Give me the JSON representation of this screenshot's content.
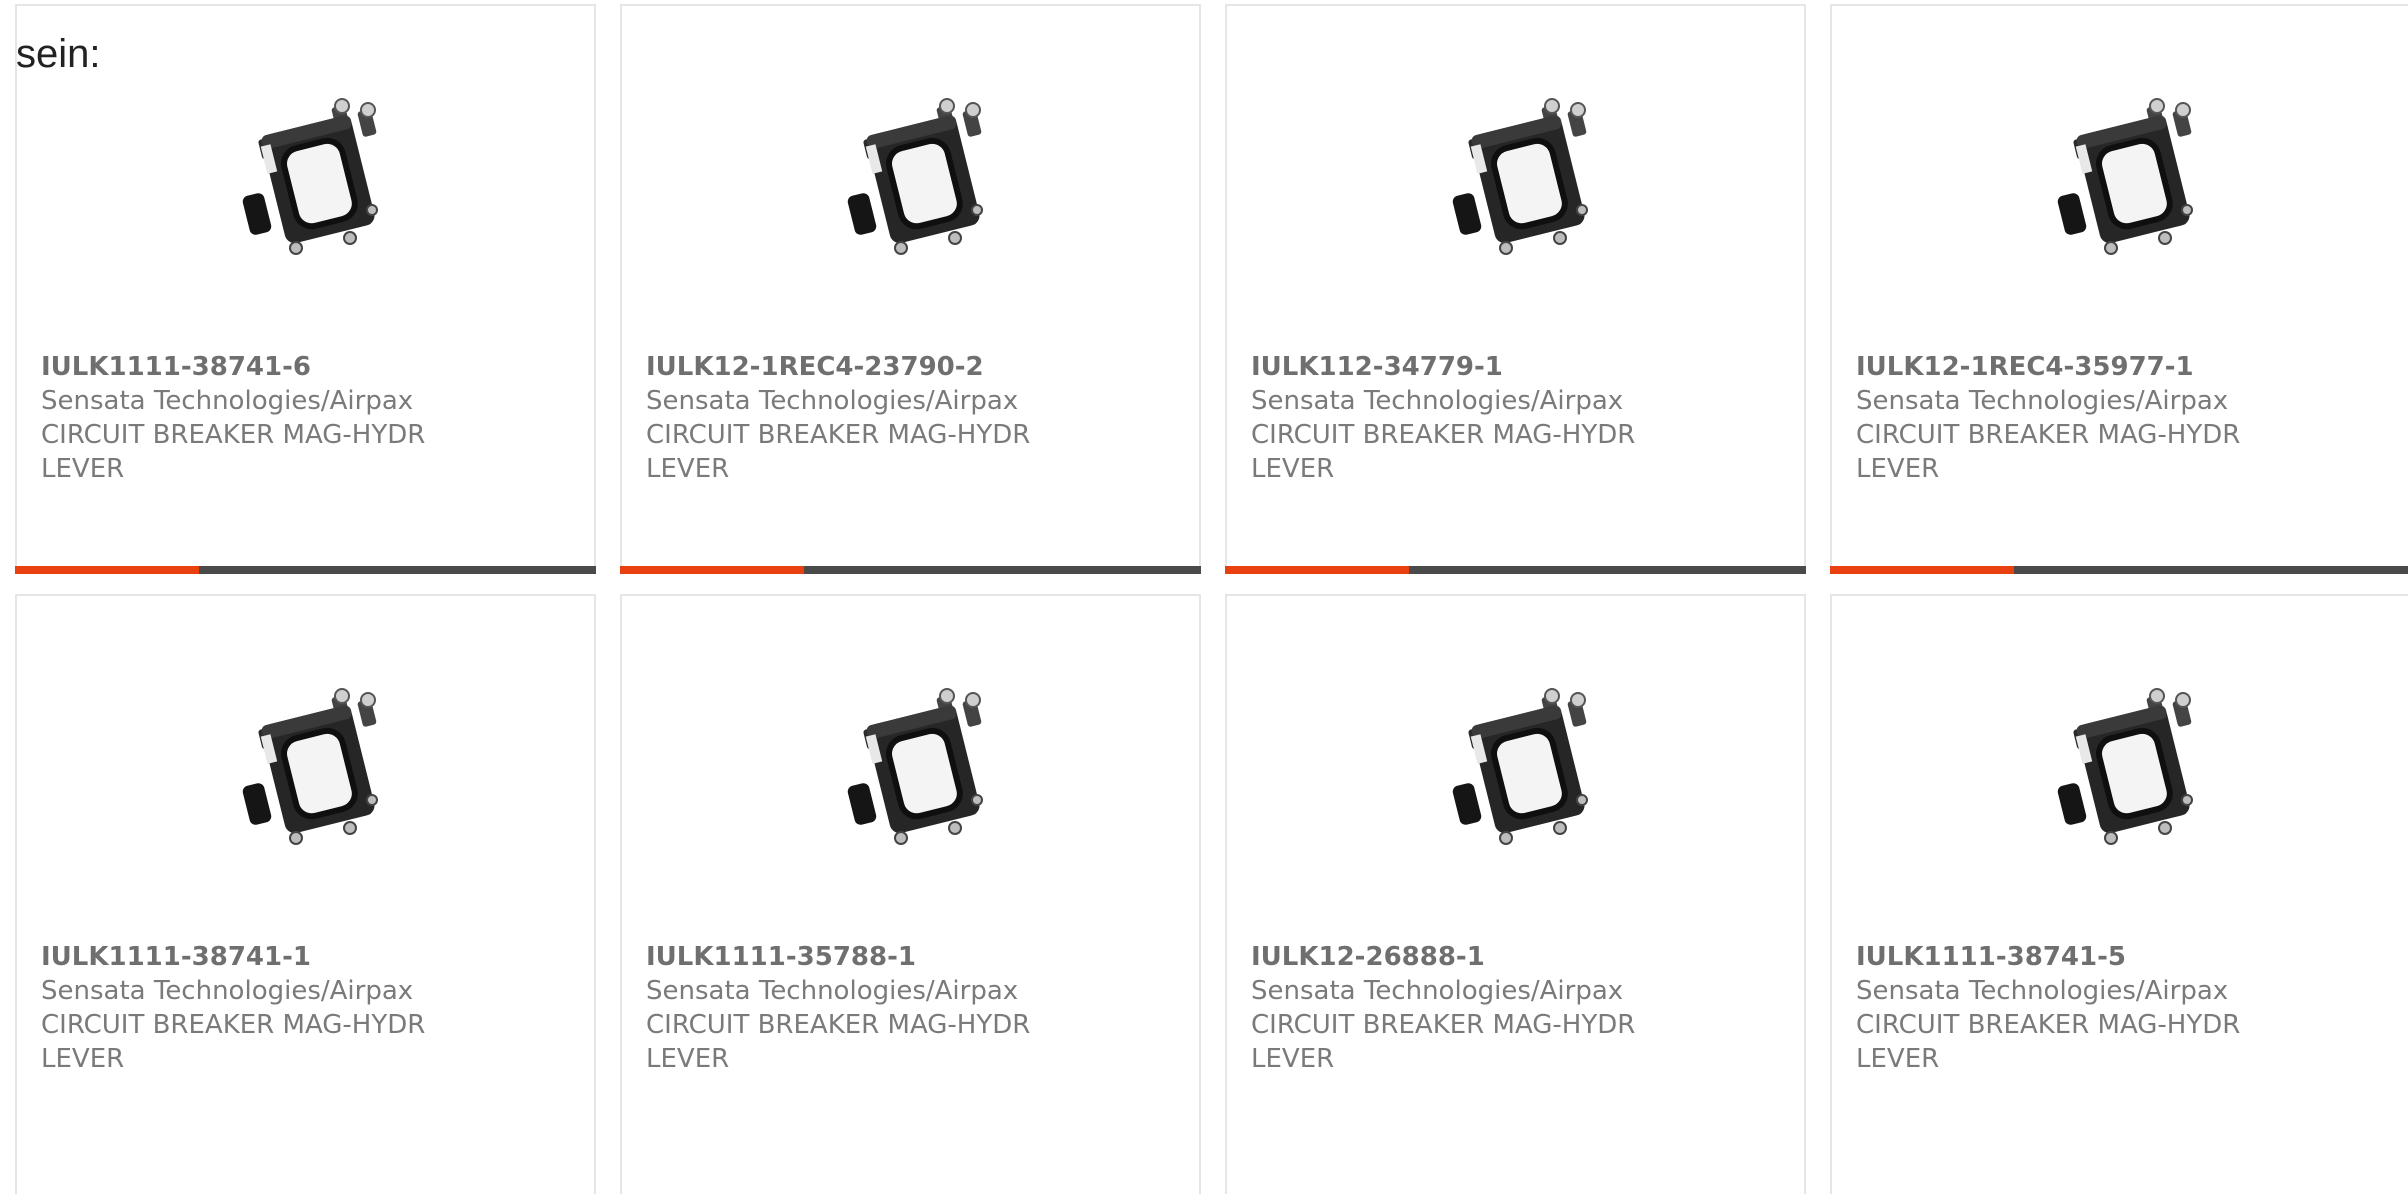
{
  "intro_text": "sein:",
  "colors": {
    "accent": "#e8410f",
    "bar_dark": "#4a4a4a",
    "border": "#e6e6e6",
    "text": "#7a7a7a"
  },
  "products": [
    {
      "part": "IULK1111-38741-6",
      "maker": "Sensata Technologies/Airpax",
      "desc1": "CIRCUIT BREAKER MAG-HYDR",
      "desc2": "LEVER",
      "image": "circuit-breaker-icon"
    },
    {
      "part": "IULK12-1REC4-23790-2",
      "maker": "Sensata Technologies/Airpax",
      "desc1": "CIRCUIT BREAKER MAG-HYDR",
      "desc2": "LEVER",
      "image": "circuit-breaker-icon"
    },
    {
      "part": "IULK112-34779-1",
      "maker": "Sensata Technologies/Airpax",
      "desc1": "CIRCUIT BREAKER MAG-HYDR",
      "desc2": "LEVER",
      "image": "circuit-breaker-icon"
    },
    {
      "part": "IULK12-1REC4-35977-1",
      "maker": "Sensata Technologies/Airpax",
      "desc1": "CIRCUIT BREAKER MAG-HYDR",
      "desc2": "LEVER",
      "image": "circuit-breaker-icon"
    },
    {
      "part": "IULK1111-38741-1",
      "maker": "Sensata Technologies/Airpax",
      "desc1": "CIRCUIT BREAKER MAG-HYDR",
      "desc2": "LEVER",
      "image": "circuit-breaker-icon"
    },
    {
      "part": "IULK1111-35788-1",
      "maker": "Sensata Technologies/Airpax",
      "desc1": "CIRCUIT BREAKER MAG-HYDR",
      "desc2": "LEVER",
      "image": "circuit-breaker-icon"
    },
    {
      "part": "IULK12-26888-1",
      "maker": "Sensata Technologies/Airpax",
      "desc1": "CIRCUIT BREAKER MAG-HYDR",
      "desc2": "LEVER",
      "image": "circuit-breaker-icon"
    },
    {
      "part": "IULK1111-38741-5",
      "maker": "Sensata Technologies/Airpax",
      "desc1": "CIRCUIT BREAKER MAG-HYDR",
      "desc2": "LEVER",
      "image": "circuit-breaker-icon"
    }
  ]
}
